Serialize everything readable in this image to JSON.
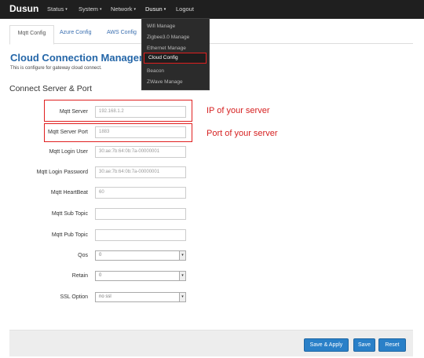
{
  "nav": {
    "brand": "Dusun",
    "items": [
      {
        "label": "Status",
        "has_caret": true
      },
      {
        "label": "System",
        "has_caret": true
      },
      {
        "label": "Network",
        "has_caret": true
      },
      {
        "label": "Dusun",
        "has_caret": true
      },
      {
        "label": "Logout",
        "has_caret": false
      }
    ],
    "caret": "▾"
  },
  "dropdown": {
    "items": [
      "Wifi Manage",
      "Zigbee3.0 Manage",
      "Ethernet Manage",
      "Cloud Config",
      "Beacon",
      "ZWave Manage"
    ],
    "active": "Cloud Config"
  },
  "tabs": [
    "Mqtt Config",
    "Azure Config",
    "AWS Config"
  ],
  "page": {
    "title": "Cloud Connection Management",
    "description": "This is configure for gateway cloud connect.",
    "section": "Connect Server & Port"
  },
  "fields": [
    {
      "label": "Mqtt Server",
      "value": "192.168.1.2"
    },
    {
      "label": "Mqtt Server Port",
      "value": "1883"
    },
    {
      "label": "Mqtt Login User",
      "value": "30:ae:7b:64:0b:7a-00000001"
    },
    {
      "label": "Mqtt Login Password",
      "value": "30:ae:7b:64:0b:7a-00000001"
    },
    {
      "label": "Mqtt HeartBeat",
      "value": "60"
    },
    {
      "label": "Mqtt Sub Topic",
      "value": ""
    },
    {
      "label": "Mqtt Pub Topic",
      "value": ""
    }
  ],
  "selects": [
    {
      "label": "Qos",
      "value": "0"
    },
    {
      "label": "Retain",
      "value": "0"
    },
    {
      "label": "SSL Option",
      "value": "no ssl"
    }
  ],
  "select_arrow": "▾",
  "annotations": {
    "server": "IP of your server",
    "port": "Port of your server"
  },
  "buttons": {
    "save_apply": "Save & Apply",
    "save": "Save",
    "reset": "Reset"
  },
  "colors": {
    "navbar": "#1f1f1f",
    "accent": "#2466a8",
    "button": "#2a80c8",
    "highlight": "#e02020"
  }
}
